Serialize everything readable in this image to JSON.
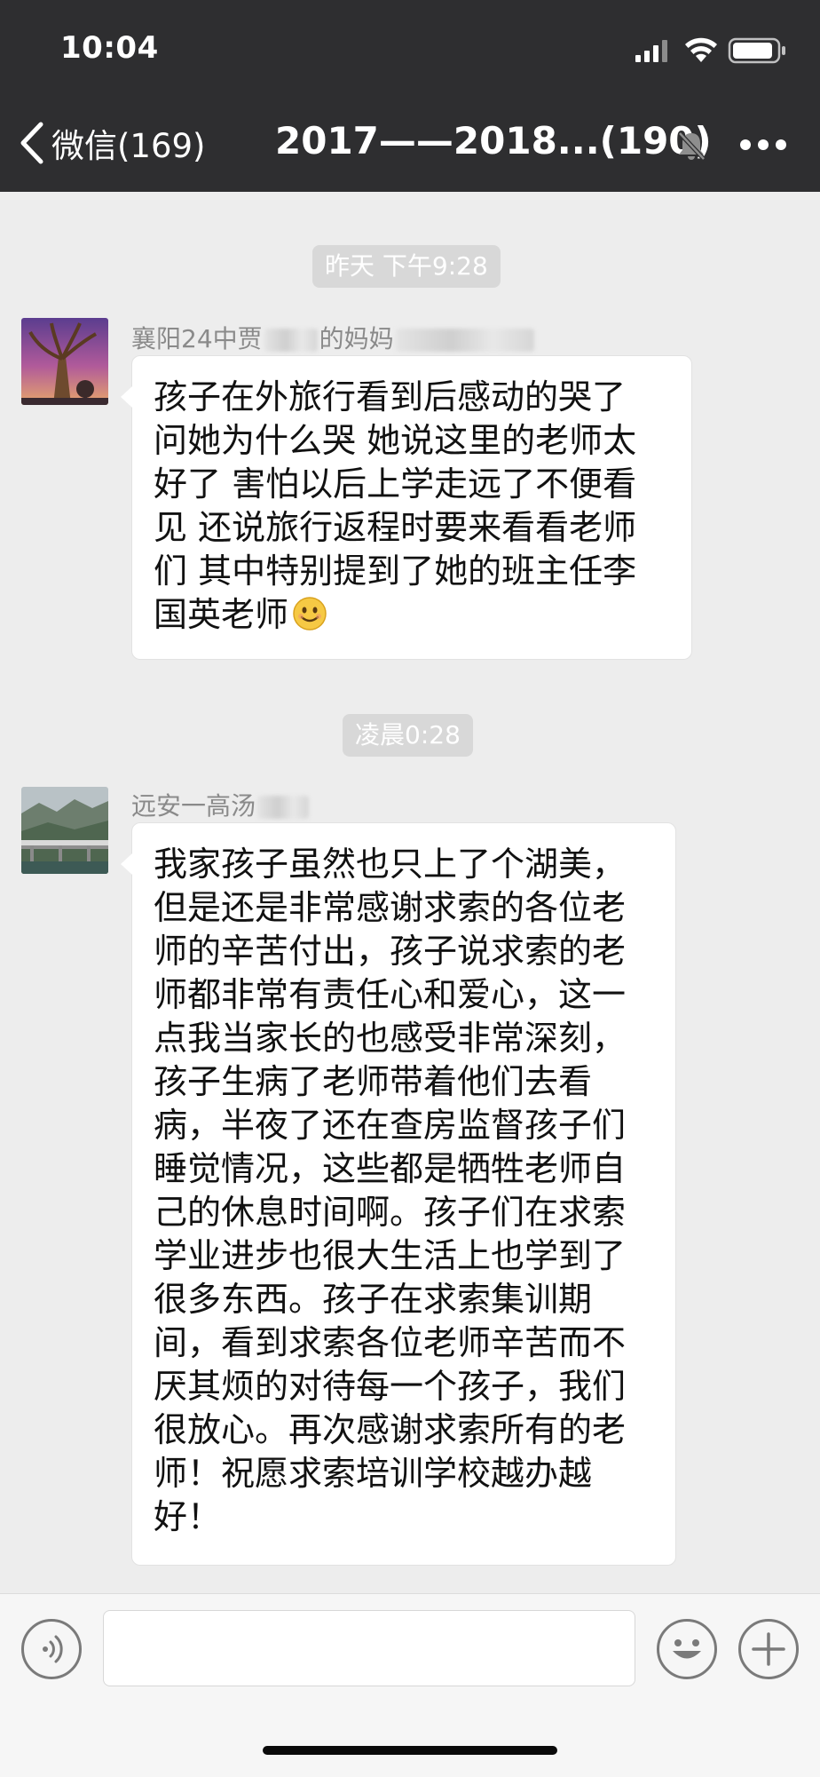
{
  "status_bar": {
    "time": "10:04"
  },
  "nav": {
    "back_label": "微信(169)",
    "title": "2017——2018...(190)"
  },
  "messages": [
    {
      "timestamp": "昨天 下午9:28",
      "sender_prefix": "襄阳24中贾",
      "sender_middle": "的妈妈",
      "lines": [
        "孩子在外旅行看到后感动的哭了",
        "问她为什么哭 她说这里的老师太",
        "好了  害怕以后上学走远了不便看",
        "见 还说旅行返程时要来看看老师",
        "们 其中特别提到了她的班主任李",
        "国英老师"
      ]
    },
    {
      "timestamp": "凌晨0:28",
      "sender_prefix": "远安一高汤",
      "lines": [
        "我家孩子虽然也只上了个湖美，",
        "但是还是非常感谢求索的各位老",
        "师的辛苦付出，孩子说求索的老",
        "师都非常有责任心和爱心，这一",
        "点我当家长的也感受非常深刻，",
        "孩子生病了老师带着他们去看",
        "病，半夜了还在查房监督孩子们",
        "睡觉情况，这些都是牺牲老师自",
        "己的休息时间啊。孩子们在求索",
        "学业进步也很大生活上也学到了",
        "很多东西。孩子在求索集训期",
        "间，看到求索各位老师辛苦而不",
        "厌其烦的对待每一个孩子，我们",
        "很放心。再次感谢求索所有的老",
        "师！祝愿求索培训学校越办越",
        "好！"
      ]
    }
  ],
  "icons": {
    "back": "chevron-left-icon",
    "mute": "bell-muted-icon",
    "more": "more-dots-icon",
    "voice": "voice-icon",
    "emoji": "emoji-icon",
    "plus": "plus-icon"
  }
}
